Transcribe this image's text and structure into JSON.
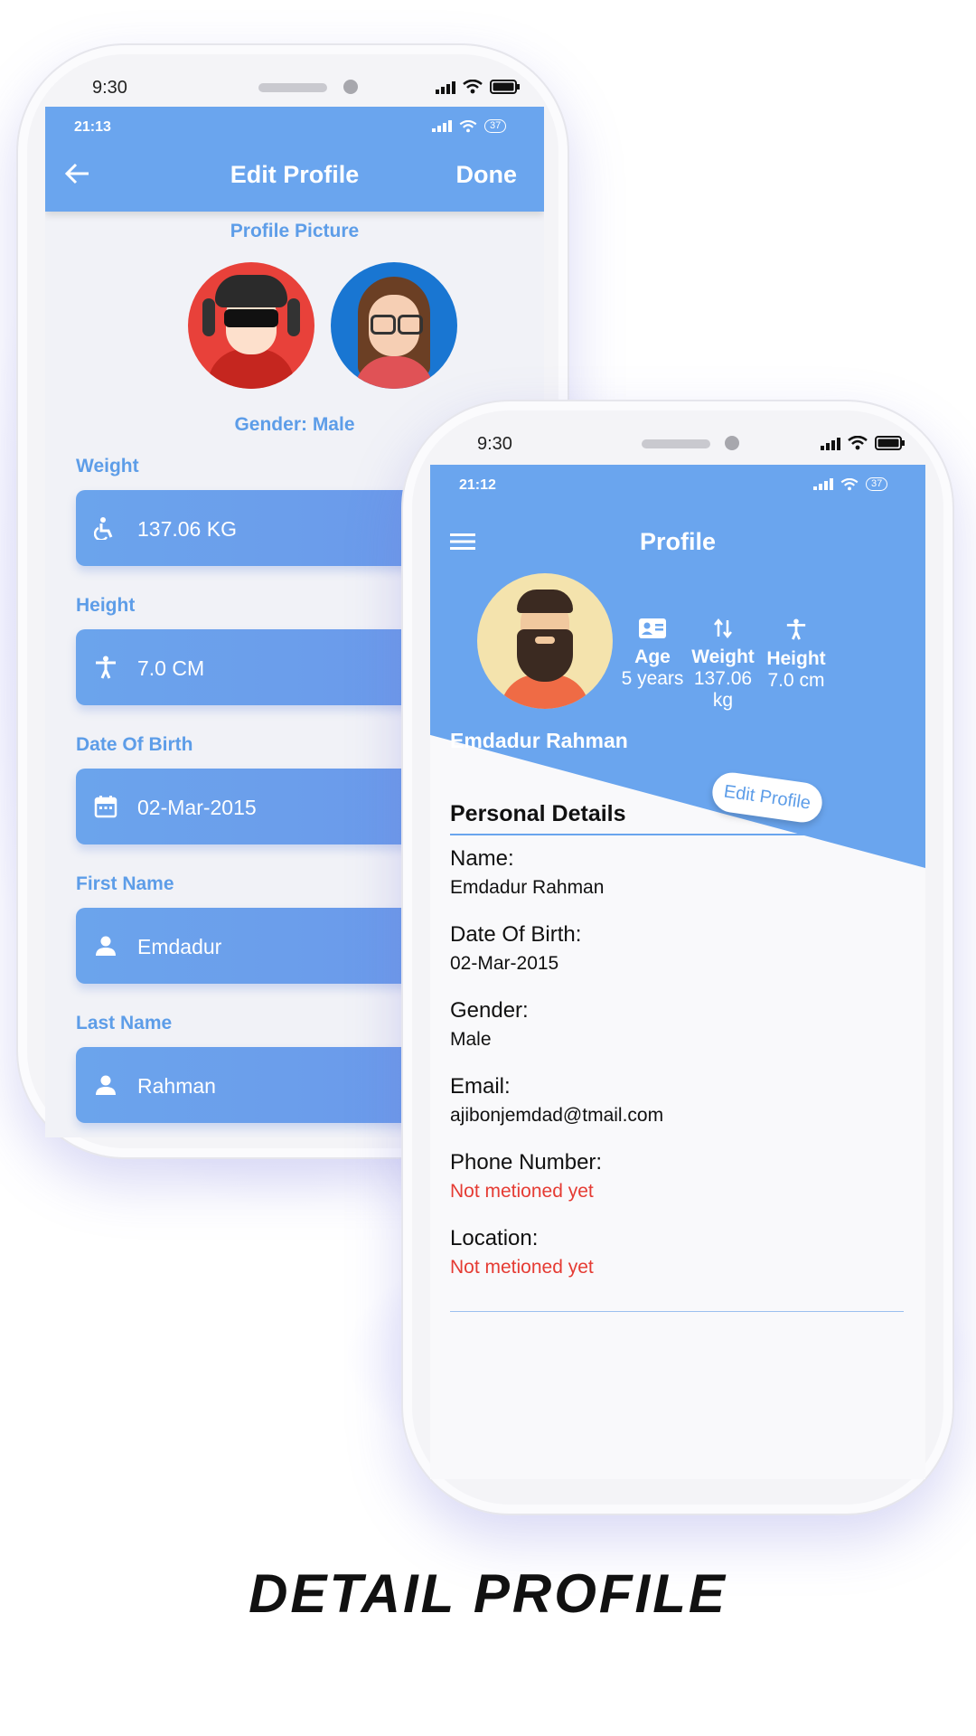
{
  "left_phone": {
    "device_time": "9:30",
    "status_time": "21:13",
    "battery": "37",
    "appbar": {
      "title": "Edit Profile",
      "done_label": "Done"
    },
    "profile_picture_label": "Profile Picture",
    "gender_label": "Gender: Male",
    "fields": [
      {
        "label": "Weight",
        "value": "137.06 KG",
        "icon": "accessibility-icon"
      },
      {
        "label": "Height",
        "value": "7.0 CM",
        "icon": "person-standing-icon"
      },
      {
        "label": "Date Of Birth",
        "value": "02-Mar-2015",
        "icon": "calendar-icon"
      },
      {
        "label": "First Name",
        "value": "Emdadur",
        "icon": "person-icon"
      },
      {
        "label": "Last Name",
        "value": "Rahman",
        "icon": "person-icon"
      }
    ]
  },
  "right_phone": {
    "device_time": "9:30",
    "status_time": "21:12",
    "battery": "37",
    "appbar": {
      "title": "Profile"
    },
    "user_name": "Emdadur Rahman",
    "stats": [
      {
        "label": "Age",
        "value": "5 years",
        "icon": "id-card-icon"
      },
      {
        "label": "Weight",
        "value": "137.06 kg",
        "icon": "swap-vertical-icon"
      },
      {
        "label": "Height",
        "value": "7.0 cm",
        "icon": "person-standing-icon"
      }
    ],
    "edit_profile_label": "Edit Profile",
    "section_title": "Personal Details",
    "details": [
      {
        "label": "Name:",
        "value": "Emdadur Rahman",
        "missing": false
      },
      {
        "label": "Date Of Birth:",
        "value": "02-Mar-2015",
        "missing": false
      },
      {
        "label": "Gender:",
        "value": "Male",
        "missing": false
      },
      {
        "label": "Email:",
        "value": "ajibonjemdad@tmail.com",
        "missing": false
      },
      {
        "label": "Phone Number:",
        "value": "Not metioned yet",
        "missing": true
      },
      {
        "label": "Location:",
        "value": "Not metioned yet",
        "missing": true
      }
    ]
  },
  "caption": "DETAIL PROFILE",
  "colors": {
    "primary": "#6aa5ee",
    "accent_text": "#5d9de8",
    "missing_value": "#e53b33"
  }
}
